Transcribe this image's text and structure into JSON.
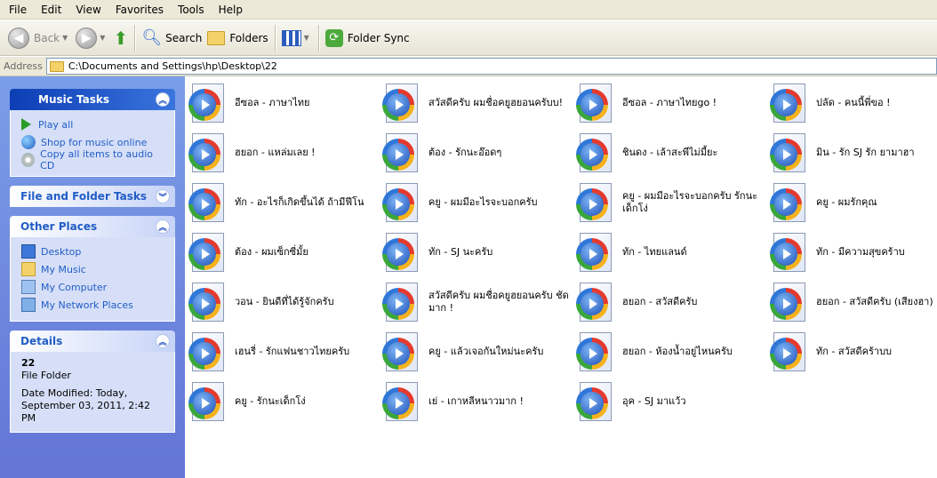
{
  "menu": [
    "File",
    "Edit",
    "View",
    "Favorites",
    "Tools",
    "Help"
  ],
  "toolbar": {
    "back": "Back",
    "search": "Search",
    "folders": "Folders",
    "sync": "Folder Sync"
  },
  "address": {
    "label": "Address",
    "path": "C:\\Documents and Settings\\hp\\Desktop\\22"
  },
  "sidebar": {
    "music_tasks": {
      "title": "Music Tasks",
      "items": [
        "Play all",
        "Shop for music online",
        "Copy all items to audio CD"
      ]
    },
    "file_tasks": {
      "title": "File and Folder Tasks"
    },
    "other_places": {
      "title": "Other Places",
      "items": [
        "Desktop",
        "My Music",
        "My Computer",
        "My Network Places"
      ]
    },
    "details": {
      "title": "Details",
      "name": "22",
      "type": "File Folder",
      "modified": "Date Modified: Today, September 03, 2011, 2:42 PM"
    }
  },
  "files": [
    "อีซอล - ภาษาไทย",
    "สวัสดีครับ ผมชื่อคยูฮยอนครับบ!",
    "อีซอล - ภาษาไทยgo !",
    "ปลัด - คนนี้พี่ขอ !",
    "ฮยอก - แหล่มเลย !",
    "ต้อง - รักนะอ๊อดๆ",
    "ชินดง - เล้าสะพีไม่มี้ยะ",
    "มิน - รัก SJ รัก ยามาฮา",
    "ทัก - อะไรก็เกิดขึ้นได้ ถ้ามีฟีโน",
    "คยู - ผมมีอะไรจะบอกครับ",
    "คยู - ผมมีอะไรจะบอกครับ รักนะเด็กโง่",
    "คยู - ผมรักคุณ",
    "ต้อง - ผมเซ็กซี่มั้ย",
    "ทัก - SJ นะครับ",
    "ทัก - ไทยแลนด์",
    "ทัก - มีความสุขคร้าบ",
    "วอน - ยินดีที่ได้รู้จักครับ",
    "สวัสดีครับ ผมชื่อคยูฮยอนครับ ชัดมาก !",
    "ฮยอก - สวัสดีครับ",
    "ฮยอก - สวัสดีครับ (เสียงฮา)",
    "เฮนรี่ - รักแฟนชาวไทยครับ",
    "คยู - แล้วเจอกันใหม่นะครับ",
    "ฮยอก - ห้องน้ำอยู่ไหนครับ",
    "ทัก - สวัสดีคร้าบบ",
    "คยู - รักนะเด็กโง่",
    "เย่ - เกาหลีหนาวมาก !",
    "อุค - SJ มาแว้ว"
  ],
  "colors": {
    "sidebar": "#6375d6",
    "link": "#215dc6"
  }
}
